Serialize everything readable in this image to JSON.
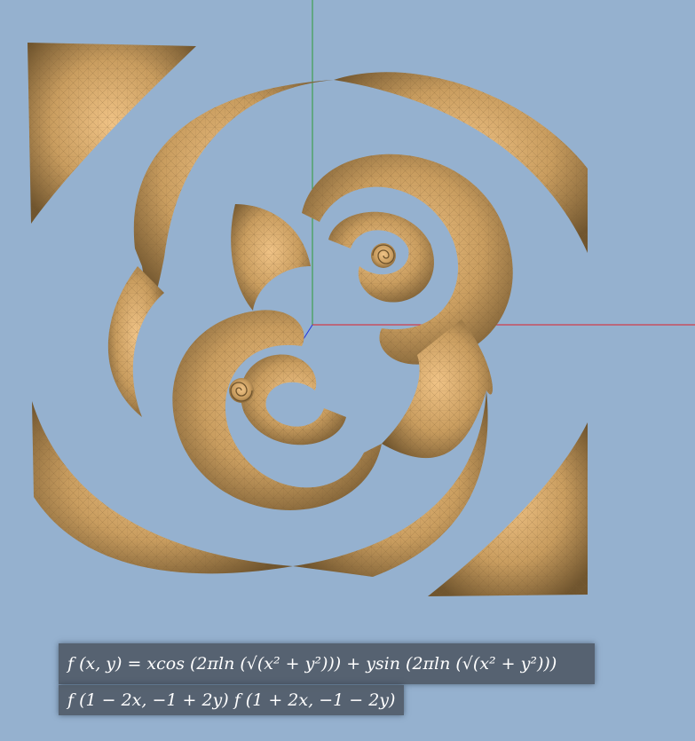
{
  "formulas": {
    "line1": "f (x, y) = xcos (2πln (√(x² + y²))) + ysin (2πln (√(x² + y²)))",
    "line2": "f (1 − 2x, −1 + 2y) f (1 + 2x, −1 − 2y)"
  },
  "colors": {
    "background": "#95b1cf",
    "surface": "#c49a5c",
    "surface_light": "#e9bd7b",
    "surface_dark": "#6e532c",
    "axis_x": "#e0202a",
    "axis_y": "#2f9a3a",
    "axis_z": "#2233dd"
  }
}
